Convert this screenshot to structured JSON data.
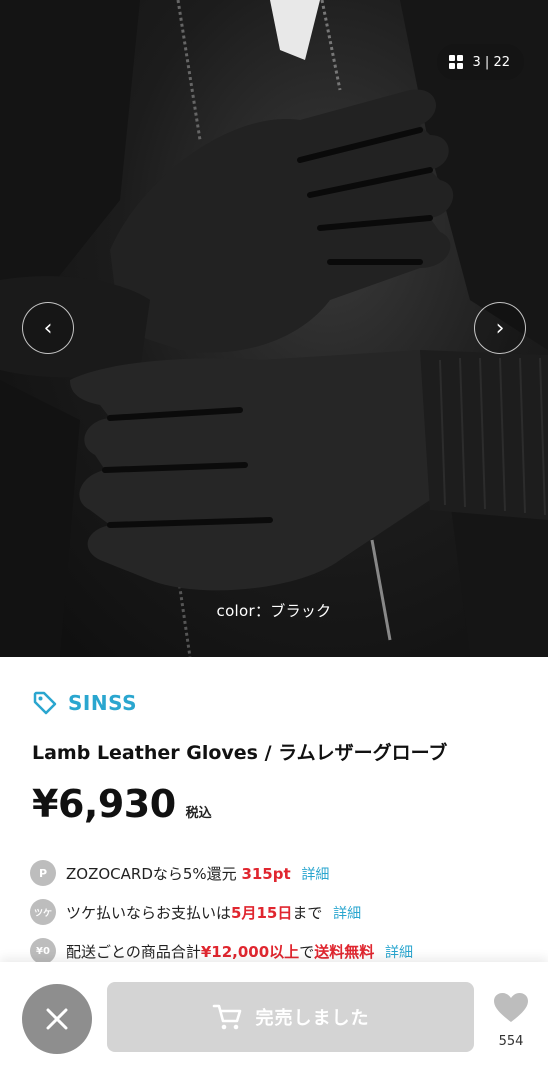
{
  "gallery": {
    "counter": "3 | 22",
    "caption": "color：ブラック",
    "icons": {
      "grid": "grid-icon",
      "prev": "chevron-left-icon",
      "next": "chevron-right-icon"
    }
  },
  "product": {
    "brand": "SINSS",
    "title": "Lamb Leather Gloves / ラムレザーグローブ",
    "price": "¥6,930",
    "tax_label": "税込"
  },
  "benefits": [
    {
      "badge": "P",
      "text_before": "ZOZOCARDなら5%還元 ",
      "highlight": "315pt",
      "text_after": "",
      "link": "詳細"
    },
    {
      "badge": "ツケ",
      "text_before": "ツケ払いならお支払いは",
      "highlight": "5月15日",
      "text_after": "まで",
      "link": "詳細"
    },
    {
      "badge": "¥0",
      "text_before": "配送ごとの商品合計",
      "highlight": "¥12,000以上",
      "text_after": "で",
      "highlight2": "送料無料",
      "link": "詳細"
    }
  ],
  "bottom_bar": {
    "soldout_label": "完売しました",
    "favorite_count": "554",
    "colors": {
      "brand": "#2aa6cf",
      "accent_red": "#e0262f",
      "disabled": "#d4d4d4"
    }
  }
}
